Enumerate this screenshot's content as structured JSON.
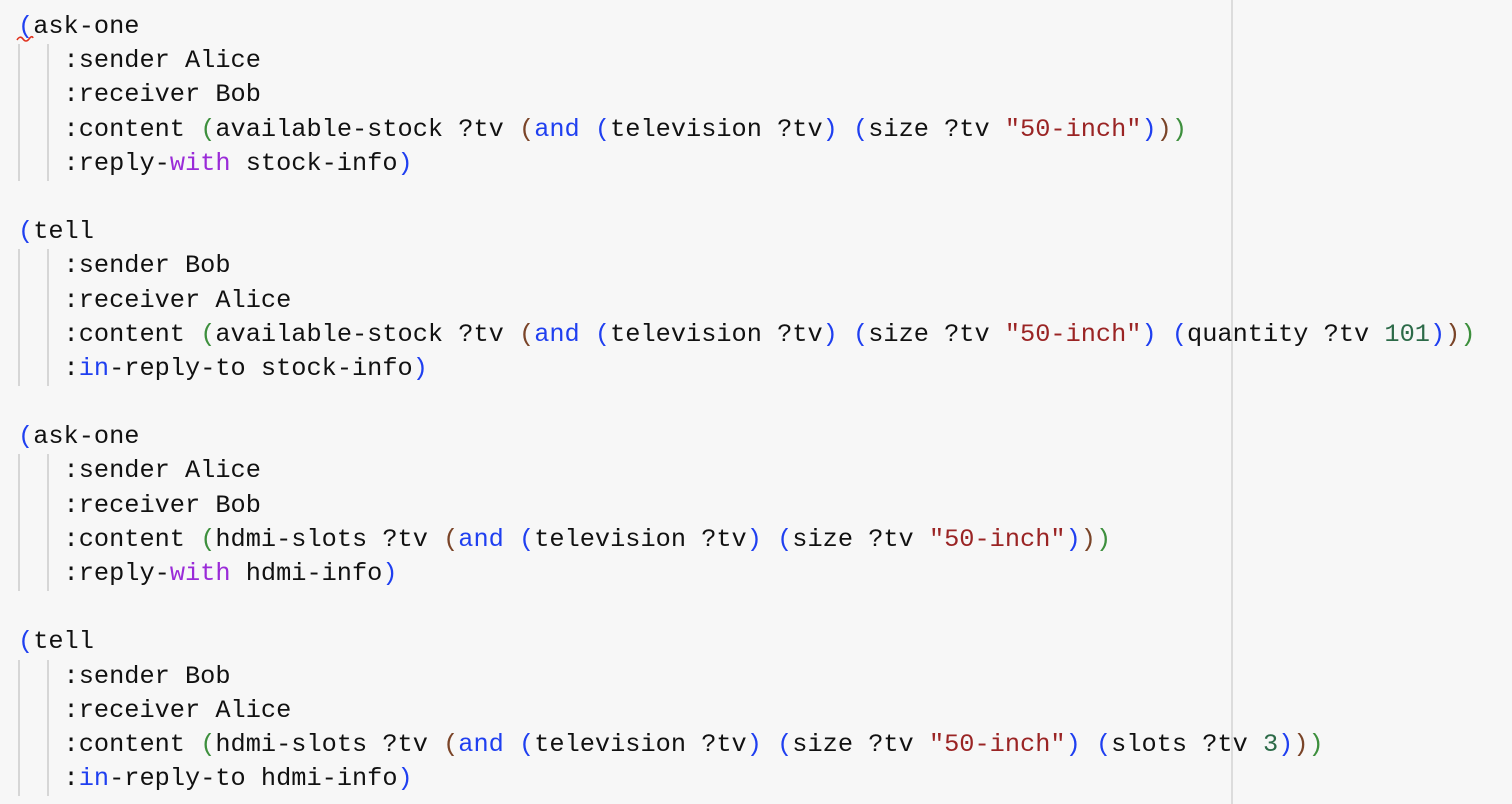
{
  "colors": {
    "paren_depth0": "#1f3ff0",
    "paren_depth1": "#3d8f3d",
    "paren_depth2": "#7a4428",
    "string": "#9a2424",
    "number": "#2c6a48",
    "keyword_with": "#9a2ad8",
    "keyword_in": "#1f3ff0",
    "background": "#f7f7f7"
  },
  "lines": [
    {
      "indent": false,
      "tokens": [
        [
          "(",
          "b"
        ],
        [
          "ask-one",
          ""
        ]
      ]
    },
    {
      "indent": true,
      "tokens": [
        [
          ":sender Alice",
          ""
        ]
      ]
    },
    {
      "indent": true,
      "tokens": [
        [
          ":receiver Bob",
          ""
        ]
      ]
    },
    {
      "indent": true,
      "tokens": [
        [
          ":content ",
          ""
        ],
        [
          "(",
          "g"
        ],
        [
          "available-stock ?tv ",
          ""
        ],
        [
          "(",
          "r"
        ],
        [
          "and",
          "k"
        ],
        [
          " ",
          ""
        ],
        [
          "(",
          "b"
        ],
        [
          "television ?tv",
          ""
        ],
        [
          ")",
          "b"
        ],
        [
          " ",
          ""
        ],
        [
          "(",
          "b"
        ],
        [
          "size ?tv ",
          ""
        ],
        [
          "\"50-inch\"",
          "s"
        ],
        [
          ")",
          "b"
        ],
        [
          ")",
          "r"
        ],
        [
          ")",
          "g"
        ]
      ]
    },
    {
      "indent": true,
      "tokens": [
        [
          ":reply-",
          ""
        ],
        [
          "with",
          "w"
        ],
        [
          " stock-info",
          ""
        ],
        [
          ")",
          "b"
        ]
      ]
    },
    {
      "indent": false,
      "tokens": []
    },
    {
      "indent": false,
      "tokens": [
        [
          "(",
          "b"
        ],
        [
          "tell",
          ""
        ]
      ]
    },
    {
      "indent": true,
      "tokens": [
        [
          ":sender Bob",
          ""
        ]
      ]
    },
    {
      "indent": true,
      "tokens": [
        [
          ":receiver Alice",
          ""
        ]
      ]
    },
    {
      "indent": true,
      "tokens": [
        [
          ":content ",
          ""
        ],
        [
          "(",
          "g"
        ],
        [
          "available-stock ?tv ",
          ""
        ],
        [
          "(",
          "r"
        ],
        [
          "and",
          "k"
        ],
        [
          " ",
          ""
        ],
        [
          "(",
          "b"
        ],
        [
          "television ?tv",
          ""
        ],
        [
          ")",
          "b"
        ],
        [
          " ",
          ""
        ],
        [
          "(",
          "b"
        ],
        [
          "size ?tv ",
          ""
        ],
        [
          "\"50-inch\"",
          "s"
        ],
        [
          ")",
          "b"
        ],
        [
          " ",
          ""
        ],
        [
          "(",
          "b"
        ],
        [
          "quantity ?tv ",
          ""
        ],
        [
          "101",
          "n"
        ],
        [
          ")",
          "b"
        ],
        [
          ")",
          "r"
        ],
        [
          ")",
          "g"
        ]
      ]
    },
    {
      "indent": true,
      "tokens": [
        [
          ":",
          ""
        ],
        [
          "in",
          "k"
        ],
        [
          "-reply-to stock-info",
          ""
        ],
        [
          ")",
          "b"
        ]
      ]
    },
    {
      "indent": false,
      "tokens": []
    },
    {
      "indent": false,
      "tokens": [
        [
          "(",
          "b"
        ],
        [
          "ask-one",
          ""
        ]
      ]
    },
    {
      "indent": true,
      "tokens": [
        [
          ":sender Alice",
          ""
        ]
      ]
    },
    {
      "indent": true,
      "tokens": [
        [
          ":receiver Bob",
          ""
        ]
      ]
    },
    {
      "indent": true,
      "tokens": [
        [
          ":content ",
          ""
        ],
        [
          "(",
          "g"
        ],
        [
          "hdmi-slots ?tv ",
          ""
        ],
        [
          "(",
          "r"
        ],
        [
          "and",
          "k"
        ],
        [
          " ",
          ""
        ],
        [
          "(",
          "b"
        ],
        [
          "television ?tv",
          ""
        ],
        [
          ")",
          "b"
        ],
        [
          " ",
          ""
        ],
        [
          "(",
          "b"
        ],
        [
          "size ?tv ",
          ""
        ],
        [
          "\"50-inch\"",
          "s"
        ],
        [
          ")",
          "b"
        ],
        [
          ")",
          "r"
        ],
        [
          ")",
          "g"
        ]
      ]
    },
    {
      "indent": true,
      "tokens": [
        [
          ":reply-",
          ""
        ],
        [
          "with",
          "w"
        ],
        [
          " hdmi-info",
          ""
        ],
        [
          ")",
          "b"
        ]
      ]
    },
    {
      "indent": false,
      "tokens": []
    },
    {
      "indent": false,
      "tokens": [
        [
          "(",
          "b"
        ],
        [
          "tell",
          ""
        ]
      ]
    },
    {
      "indent": true,
      "tokens": [
        [
          ":sender Bob",
          ""
        ]
      ]
    },
    {
      "indent": true,
      "tokens": [
        [
          ":receiver Alice",
          ""
        ]
      ]
    },
    {
      "indent": true,
      "tokens": [
        [
          ":content ",
          ""
        ],
        [
          "(",
          "g"
        ],
        [
          "hdmi-slots ?tv ",
          ""
        ],
        [
          "(",
          "r"
        ],
        [
          "and",
          "k"
        ],
        [
          " ",
          ""
        ],
        [
          "(",
          "b"
        ],
        [
          "television ?tv",
          ""
        ],
        [
          ")",
          "b"
        ],
        [
          " ",
          ""
        ],
        [
          "(",
          "b"
        ],
        [
          "size ?tv ",
          ""
        ],
        [
          "\"50-inch\"",
          "s"
        ],
        [
          ")",
          "b"
        ],
        [
          " ",
          ""
        ],
        [
          "(",
          "b"
        ],
        [
          "slots ?tv ",
          ""
        ],
        [
          "3",
          "n"
        ],
        [
          ")",
          "b"
        ],
        [
          ")",
          "r"
        ],
        [
          ")",
          "g"
        ]
      ]
    },
    {
      "indent": true,
      "tokens": [
        [
          ":",
          ""
        ],
        [
          "in",
          "k"
        ],
        [
          "-reply-to hdmi-info",
          ""
        ],
        [
          ")",
          "b"
        ]
      ]
    }
  ]
}
